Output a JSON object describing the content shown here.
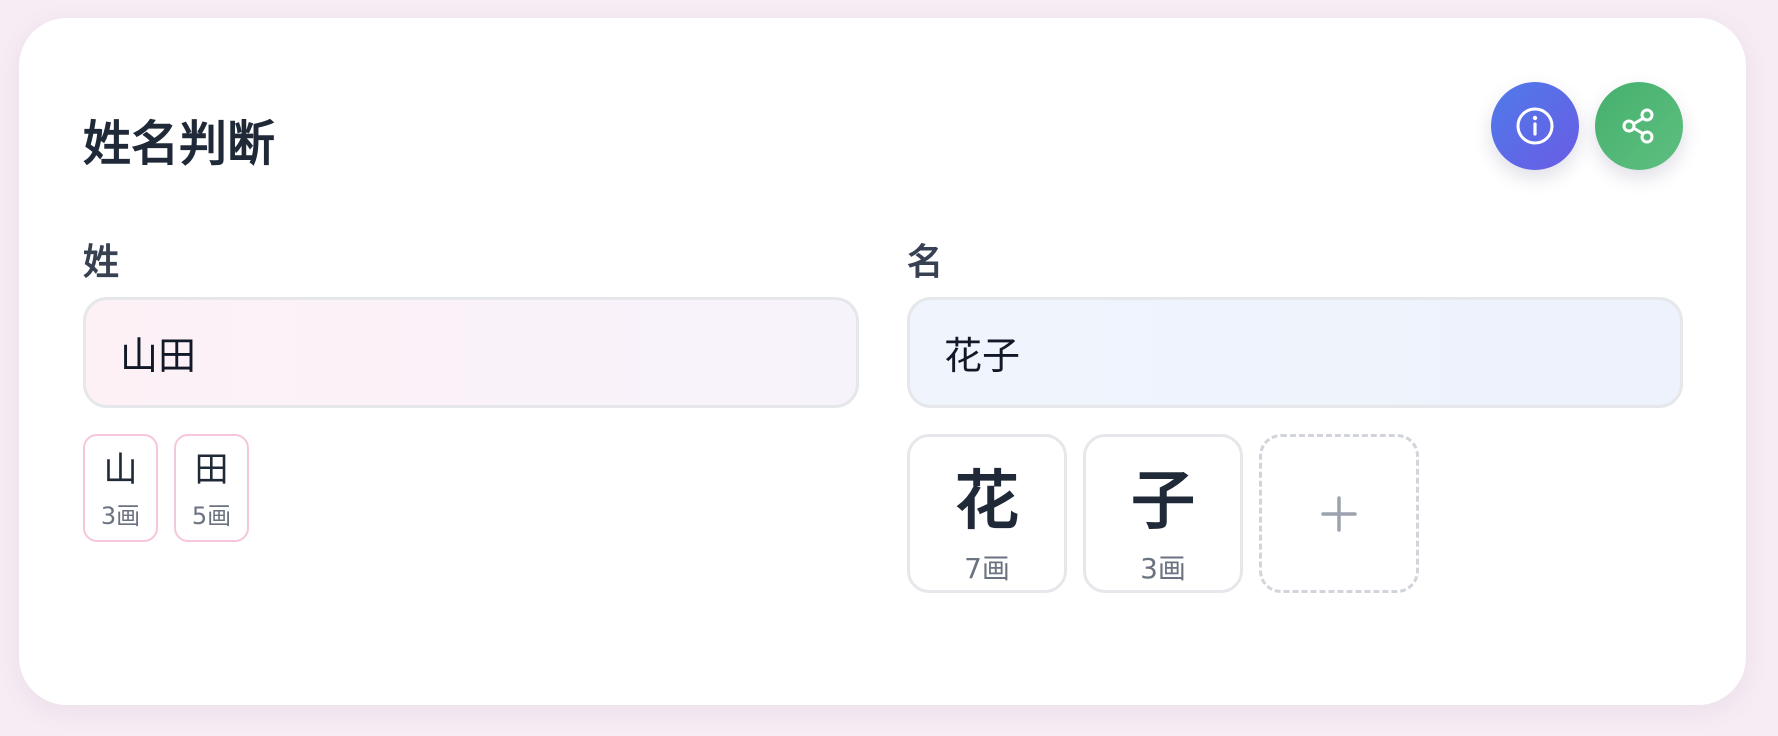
{
  "header": {
    "title": "姓名判断",
    "info_icon": "info-icon",
    "share_icon": "share-icon",
    "info_color": "#5b6ee8",
    "share_color": "#50b574"
  },
  "surname": {
    "label": "姓",
    "value": "山田",
    "chars": [
      {
        "char": "山",
        "strokes": "3画"
      },
      {
        "char": "田",
        "strokes": "5画"
      }
    ]
  },
  "given_name": {
    "label": "名",
    "value": "花子",
    "chars": [
      {
        "char": "花",
        "strokes": "7画"
      },
      {
        "char": "子",
        "strokes": "3画"
      }
    ],
    "add_icon": "plus-icon"
  }
}
